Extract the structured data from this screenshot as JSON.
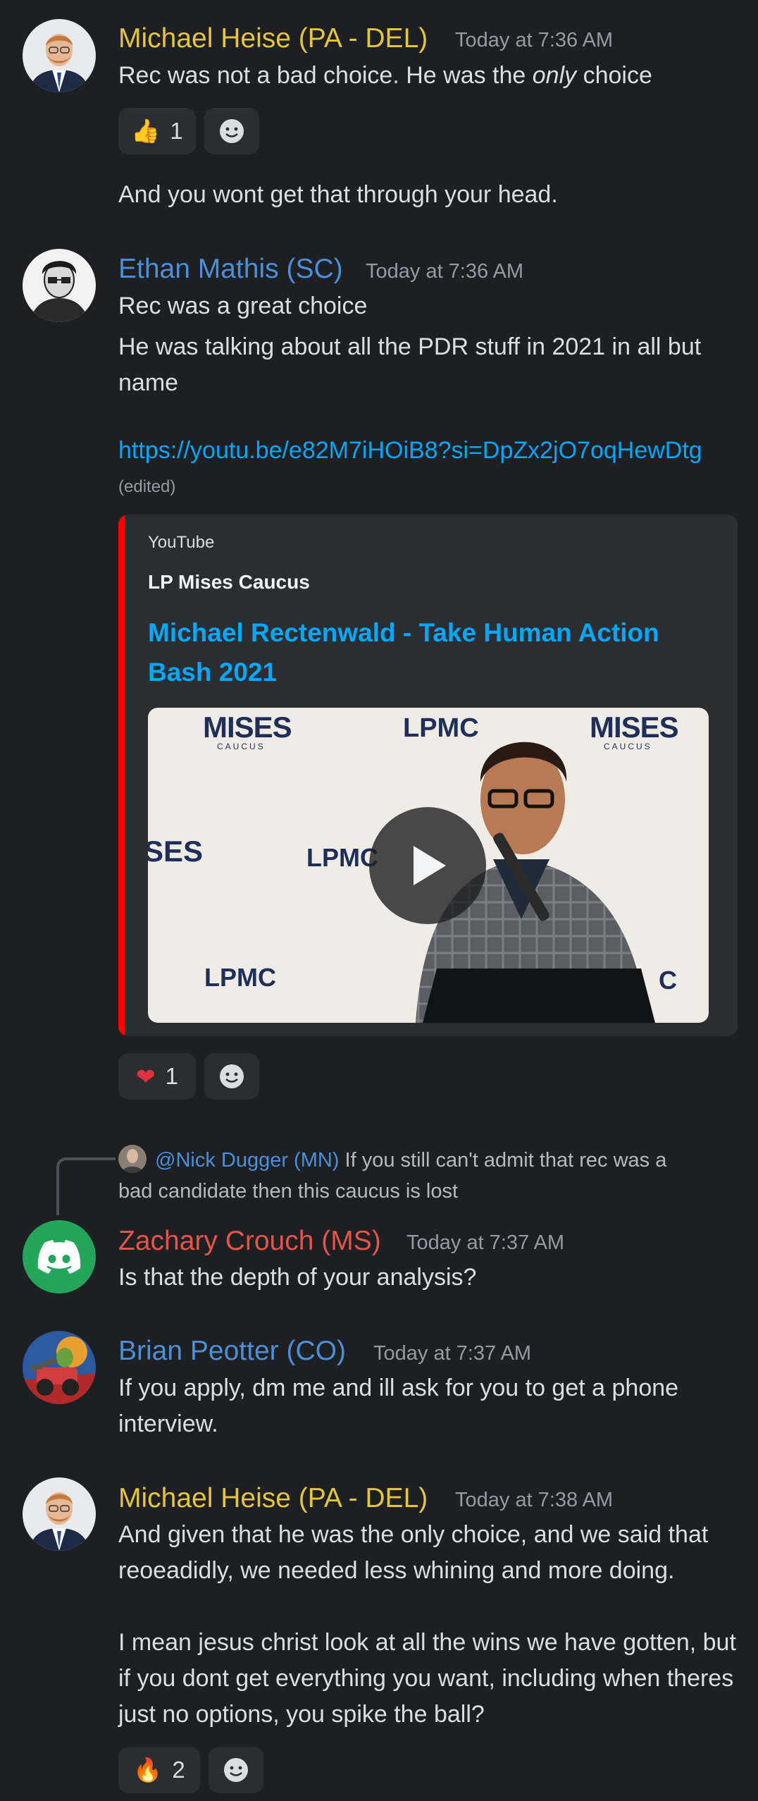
{
  "messages": [
    {
      "author": "Michael Heise (PA - DEL)",
      "timestamp": "Today at 7:36 AM",
      "text_pre": "Rec was not a bad choice. He was the ",
      "text_em": "only",
      "text_post": " choice",
      "reaction": {
        "emoji": "👍",
        "count": "1"
      },
      "followup": "And you wont get that through your head."
    },
    {
      "author": "Ethan Mathis (SC)",
      "timestamp": "Today at 7:36 AM",
      "line1": "Rec was a great choice",
      "line2": "He was talking about all the PDR stuff in 2021 in all but name",
      "link": "https://youtu.be/e82M7iHOiB8?si=DpZx2jO7oqHewDtg",
      "edited": "(edited)",
      "embed": {
        "provider": "YouTube",
        "author": "LP Mises Caucus",
        "title": "Michael Rectenwald - Take Human Action Bash 2021",
        "thumb_logos": [
          "MISES",
          "LPMC",
          "MISES",
          "SES",
          "LPMC",
          "LPMC",
          "C"
        ],
        "caucus": "CAUCUS"
      },
      "reaction": {
        "emoji": "❤",
        "count": "1"
      }
    },
    {
      "reply_author": "@Nick Dugger (MN)",
      "reply_text": "If you still can't admit that rec was a bad candidate then this caucus is lost",
      "author": "Zachary Crouch (MS)",
      "timestamp": "Today at 7:37 AM",
      "text": "Is that the depth of your analysis?"
    },
    {
      "author": "Brian Peotter (CO)",
      "timestamp": "Today at 7:37 AM",
      "text": "If you apply,  dm me and ill ask for you to get a phone interview."
    },
    {
      "author": "Michael Heise (PA - DEL)",
      "timestamp": "Today at 7:38 AM",
      "text1": "And given that he was the only choice, and we said that reoeadidly, we needed less whining and more doing.",
      "text2": "I mean jesus christ look at all the wins we have gotten, but if you dont get everything you want, including when theres just no options, you spike the ball?",
      "reaction": {
        "emoji": "🔥",
        "count": "2"
      }
    }
  ],
  "colors": {
    "background": "#1e1f22",
    "yellow_name": "#e5c63a",
    "blue_name": "#4a90d9",
    "red_name": "#e5534b",
    "link": "#00a8fc",
    "embed_bar": "#ff0000",
    "discord_green": "#23a55a"
  }
}
